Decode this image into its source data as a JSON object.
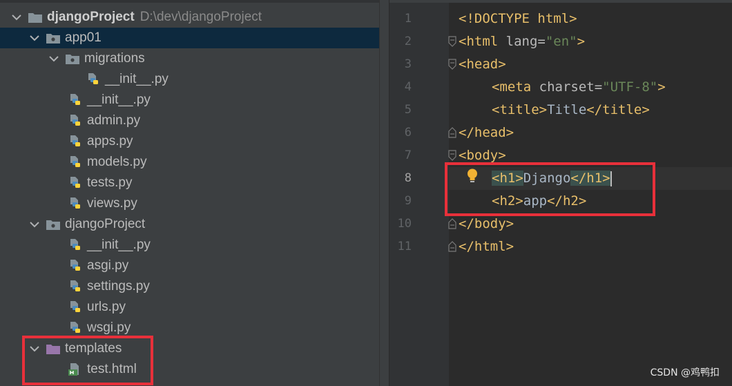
{
  "project_tree": {
    "root": {
      "name": "djangoProject",
      "path": "D:\\dev\\djangoProject"
    },
    "app01": {
      "name": "app01",
      "migrations": {
        "name": "migrations",
        "init": "__init__.py"
      },
      "files": [
        "__init__.py",
        "admin.py",
        "apps.py",
        "models.py",
        "tests.py",
        "views.py"
      ]
    },
    "djangoProject": {
      "name": "djangoProject",
      "files": [
        "__init__.py",
        "asgi.py",
        "settings.py",
        "urls.py",
        "wsgi.py"
      ]
    },
    "templates": {
      "name": "templates",
      "files": [
        "test.html"
      ]
    }
  },
  "editor": {
    "line_numbers": [
      "1",
      "2",
      "3",
      "4",
      "5",
      "6",
      "7",
      "8",
      "9",
      "10",
      "11"
    ],
    "current_line": "8",
    "code": {
      "l1": "<!DOCTYPE html>",
      "l2_open": "<html ",
      "l2_attr": "lang=",
      "l2_val": "\"en\"",
      "l2_close": ">",
      "l3": "<head>",
      "l4_open": "<meta ",
      "l4_attr": "charset=",
      "l4_val": "\"UTF-8\"",
      "l4_close": ">",
      "l5_open": "<title>",
      "l5_text": "Title",
      "l5_close": "</title>",
      "l6": "</head>",
      "l7": "<body>",
      "l8_open": "<h1>",
      "l8_text": "Django",
      "l8_close": "</h1>",
      "l9_open": "<h2>",
      "l9_text": "app",
      "l9_close": "</h2>",
      "l10": "</body>",
      "l11": "</html>"
    }
  },
  "watermark": "CSDN @鸡鸭扣",
  "colors": {
    "tree_bg": "#3c3f41",
    "selected_row": "#0d293e",
    "editor_bg": "#2b2b2b",
    "tag": "#e8bf6a",
    "string": "#6a8759",
    "highlight_box": "#e8303a",
    "folder_templates": "#9876aa"
  }
}
